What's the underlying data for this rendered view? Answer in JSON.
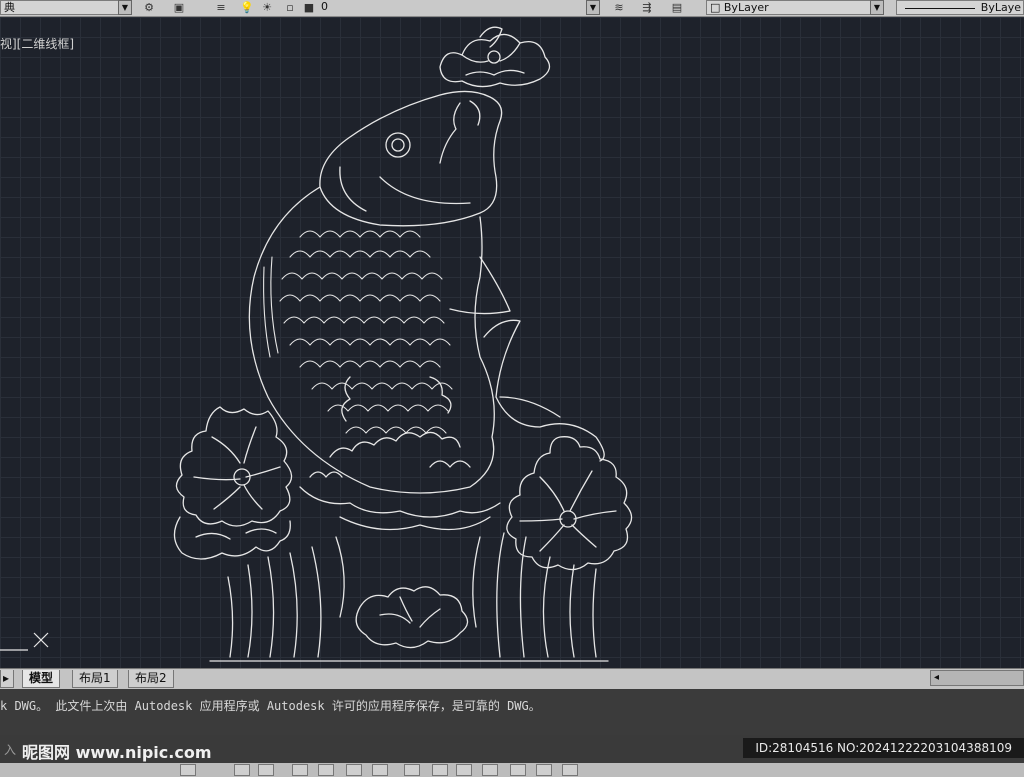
{
  "toolbar": {
    "style_value": "典",
    "layer_value": "0",
    "color_value": "ByLayer",
    "linetype_value": "ByLaye",
    "icons": [
      "gear-icon",
      "workspace-icon",
      "layer-props-icon",
      "lightbulb-icon",
      "sun-icon",
      "lock-icon",
      "color-square-icon",
      "match-prop-icon",
      "layer-prev-icon",
      "layer-state-icon"
    ]
  },
  "viewport": {
    "label": "视][二维线框]"
  },
  "tabs": {
    "model": "模型",
    "layout1": "布局1",
    "layout2": "布局2"
  },
  "command": {
    "message": "k DWG。  此文件上次由 Autodesk 应用程序或 Autodesk 许可的应用程序保存，是可靠的 DWG。",
    "prompt": "入"
  },
  "watermark": {
    "site": "昵图网 www.nipic.com",
    "id_text": "ID:28104516 NO:20241222203104388109"
  },
  "colors": {
    "line": "#e6e6e6",
    "background": "#1e222b"
  }
}
